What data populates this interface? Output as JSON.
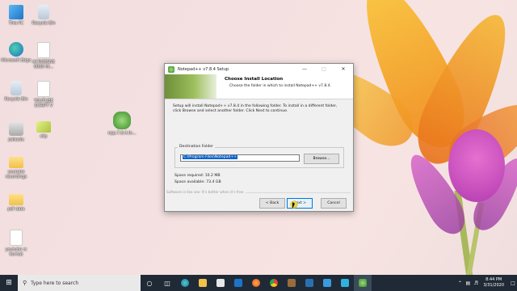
{
  "desktop": {
    "icons": [
      {
        "label": "This PC",
        "icon": "computer-icon"
      },
      {
        "label": "Recycle Bin",
        "icon": "recycle-bin-icon"
      },
      {
        "label": "Microsoft Edge",
        "icon": "edge-icon"
      },
      {
        "label": "ACROBSNS 0000 HI...",
        "icon": "document-icon"
      },
      {
        "label": "Recycle Bin",
        "icon": "recycle-bin-icon"
      },
      {
        "label": "YOUTUBE SCRIPT V",
        "icon": "document-icon"
      },
      {
        "label": "npp.7.8.4.In...",
        "icon": "notepad-plus-plus-icon"
      },
      {
        "label": "paisadu",
        "icon": "camera-icon"
      },
      {
        "label": "clip",
        "icon": "image-icon"
      },
      {
        "label": "youtube recordings",
        "icon": "folder-icon"
      },
      {
        "label": "pdf data",
        "icon": "folder-icon"
      },
      {
        "label": "youtube rc format",
        "icon": "document-icon"
      }
    ]
  },
  "dialog": {
    "title": "Notepad++ v7.8.4 Setup",
    "header_title": "Choose Install Location",
    "header_subtitle": "Choose the folder in which to install Notepad++ v7.8.4.",
    "body_text": "Setup will install Notepad++ v7.8.4 in the following folder. To install in a different folder, click Browse and select another folder. Click Next to continue.",
    "destination_label": "Destination Folder",
    "destination_value": "C:\\Program Files\\Notepad++",
    "browse_label": "Browse...",
    "space_required": "Space required: 10.2 MB",
    "space_available": "Space available: 73.4 GB",
    "branding": "Software is like sex: It's better when it's free",
    "back_label": "< Back",
    "next_label": "Next >",
    "cancel_label": "Cancel"
  },
  "taskbar": {
    "search_placeholder": "Type here to search",
    "time": "8:44 PM",
    "date": "3/31/2020"
  }
}
